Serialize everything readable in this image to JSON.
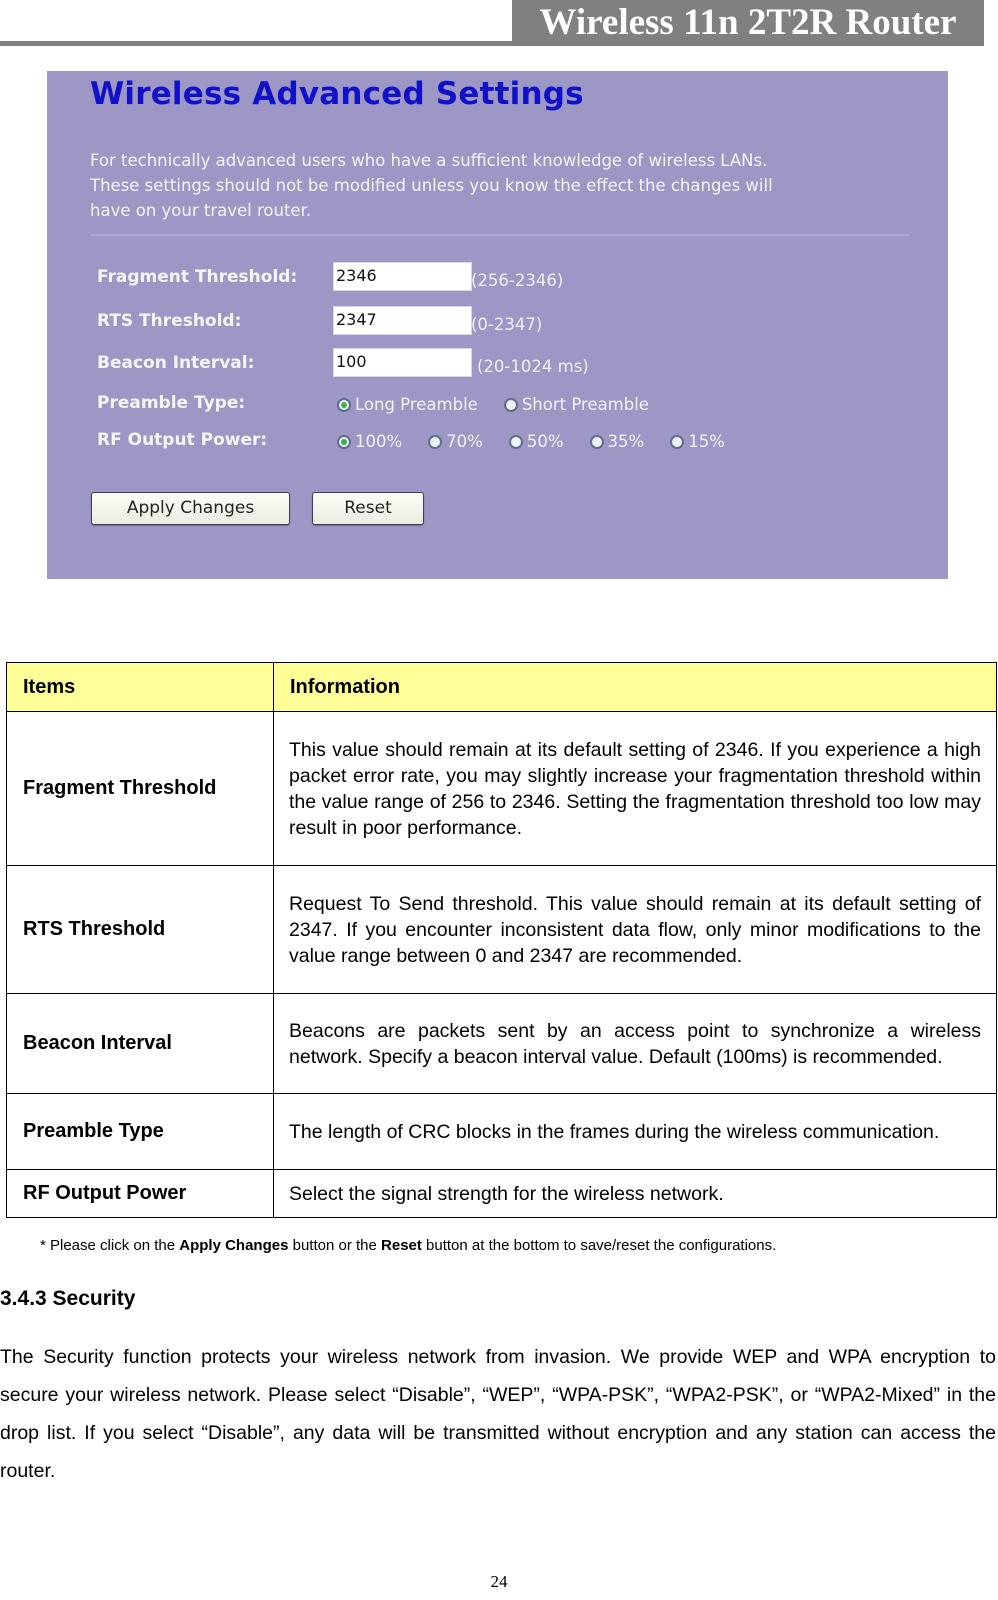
{
  "header": {
    "title": "Wireless 11n 2T2R Router"
  },
  "settings_panel": {
    "title": "Wireless Advanced Settings",
    "description_lines": [
      "For technically advanced users who have a sufficient knowledge of wireless LANs.",
      "These settings should not be modified unless you know the effect the changes will",
      "have on your travel router."
    ],
    "fields": {
      "fragment_threshold": {
        "label": "Fragment Threshold:",
        "value": "2346",
        "range": "(256-2346)"
      },
      "rts_threshold": {
        "label": "RTS Threshold:",
        "value": "2347",
        "range": "(0-2347)"
      },
      "beacon_interval": {
        "label": "Beacon Interval:",
        "value": "100",
        "range": "(20-1024 ms)"
      }
    },
    "preamble_type": {
      "label": "Preamble Type:",
      "options": [
        "Long Preamble",
        "Short Preamble"
      ],
      "selected": "Long Preamble"
    },
    "rf_output_power": {
      "label": "RF Output Power:",
      "options": [
        "100%",
        "70%",
        "50%",
        "35%",
        "15%"
      ],
      "selected": "100%"
    },
    "buttons": {
      "apply": "Apply Changes",
      "reset": "Reset"
    },
    "colors": {
      "background": "#9d97c5",
      "title": "#1010c8"
    }
  },
  "info_table": {
    "headers": [
      "Items",
      "Information"
    ],
    "header_color": "#ffff99",
    "rows": [
      {
        "item": "Fragment Threshold",
        "info": "This value should remain at its default setting of 2346. If you experience a high packet error rate, you may slightly increase your fragmentation threshold within the value range of 256 to 2346. Setting the fragmentation threshold too low may result in poor performance."
      },
      {
        "item": "RTS Threshold",
        "info": "Request To Send threshold. This value should remain at its default setting of 2347. If you encounter inconsistent data flow, only minor modifications to the value range between 0 and 2347 are recommended."
      },
      {
        "item": "Beacon Interval",
        "info": "Beacons are packets sent by an access point to synchronize a wireless network. Specify a beacon interval value. Default (100ms) is recommended."
      },
      {
        "item": "Preamble Type",
        "info": "The length of CRC blocks in the frames during the wireless communication."
      },
      {
        "item": "RF Output Power",
        "info": "Select the signal strength for the wireless network."
      }
    ]
  },
  "footnote": {
    "prefix": "* Please click on the ",
    "bold1": "Apply Changes",
    "middle": " button or the ",
    "bold2": "Reset",
    "suffix": " button at the bottom to save/reset the configurations."
  },
  "section": {
    "heading": "3.4.3 Security",
    "body": "The Security function protects your wireless network from invasion. We provide WEP and WPA encryption to secure your wireless network. Please select “Disable”, “WEP”, “WPA-PSK”, “WPA2-PSK”, or “WPA2-Mixed” in the drop list. If you select “Disable”, any data will be transmitted without encryption and any station can access the router."
  },
  "page_number": "24"
}
